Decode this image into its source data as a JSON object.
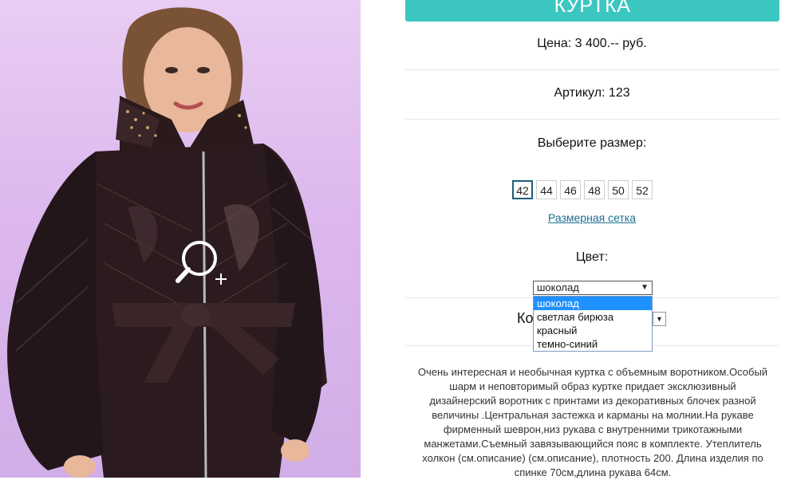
{
  "product": {
    "title": "КУРТКА",
    "price": "Цена: 3 400.-- руб.",
    "article": "Артикул: 123"
  },
  "size_section": {
    "label": "Выберите размер:",
    "sizes": [
      "42",
      "44",
      "46",
      "48",
      "50",
      "52"
    ],
    "selected": "42",
    "size_chart_link": "Размерная сетка"
  },
  "color_section": {
    "label": "Цвет:",
    "selected_value": "шоколад",
    "options": [
      "шоколад",
      "светлая бирюза",
      "красный",
      "темно-синий"
    ]
  },
  "quantity_section": {
    "label_partial": "Ко"
  },
  "description": "Очень интересная и необычная куртка с объемным воротником.Особый шарм и неповторимый образ куртке придает эксклюзивный дизайнерский воротник с принтами из декоративных блочек разной величины .Центральная застежка и карманы на молнии.На рукаве фирменный шеврон,низ рукава с внутренними трикотажными манжетами.Съемный завязывающийся пояс в комплекте. Утеплитель холкон (см.описание) (см.описание), плотность 200. Длина изделия по спинке 70см,длина рукава 64см.",
  "colors": {
    "title_bar": "#3cc6c1",
    "link": "#1b6f93",
    "dropdown_highlight": "#1e90ff"
  },
  "icons": {
    "zoom": "zoom-in-icon",
    "select_arrow": "triangle-down-icon"
  }
}
